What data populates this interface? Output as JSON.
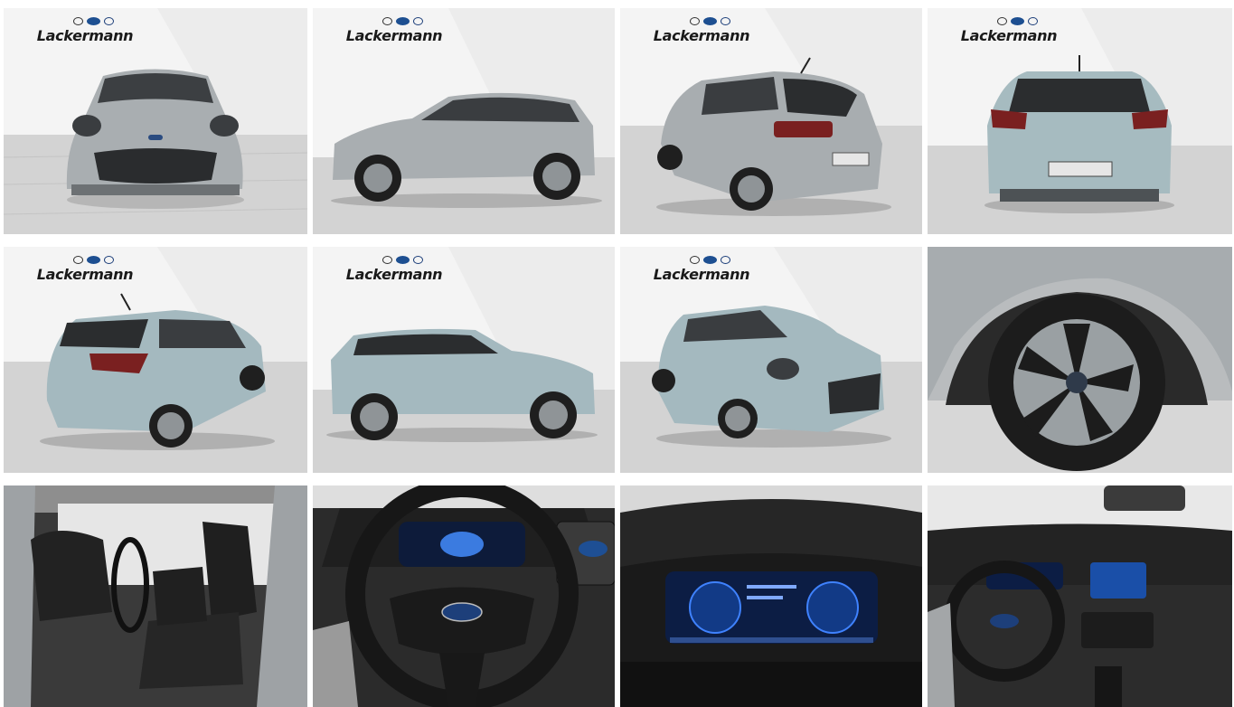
{
  "gallery": {
    "dealer_logo_text": "Lackermann",
    "photos": [
      {
        "id": "front",
        "label": "front-view",
        "has_logo": true
      },
      {
        "id": "side-left",
        "label": "side-view",
        "has_logo": true
      },
      {
        "id": "rear-three-quarter",
        "label": "rear-three-quarter-view",
        "has_logo": true
      },
      {
        "id": "rear",
        "label": "rear-view",
        "has_logo": true
      },
      {
        "id": "rear-three-quarter-2",
        "label": "rear-three-quarter-view",
        "has_logo": true
      },
      {
        "id": "side-right",
        "label": "side-view",
        "has_logo": true
      },
      {
        "id": "front-three-quarter",
        "label": "front-three-quarter-view",
        "has_logo": true
      },
      {
        "id": "wheel",
        "label": "wheel-closeup",
        "has_logo": false
      },
      {
        "id": "interior-seats",
        "label": "interior-front-seats",
        "has_logo": false
      },
      {
        "id": "steering-wheel",
        "label": "steering-wheel-closeup",
        "has_logo": false
      },
      {
        "id": "cluster",
        "label": "instrument-cluster",
        "has_logo": false
      },
      {
        "id": "dashboard",
        "label": "dashboard-view",
        "has_logo": false
      }
    ],
    "colors": {
      "backdrop": "#f2f2f2",
      "floor": "#cfcfcf",
      "car_silver": "#a9b1b4",
      "car_blue_silver": "#a4b9bf",
      "interior_dark": "#2b2b2b",
      "screen_blue": "#2f6fd6"
    }
  }
}
